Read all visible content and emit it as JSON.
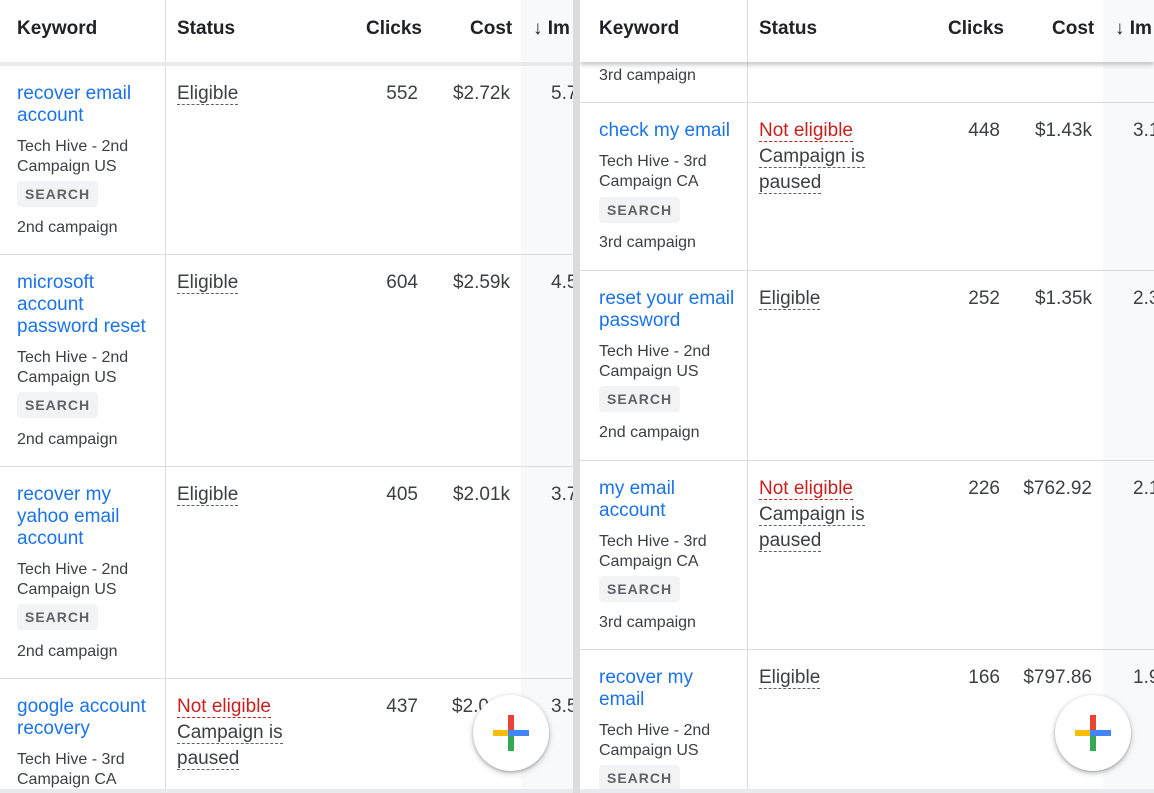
{
  "headers": {
    "keyword": "Keyword",
    "status": "Status",
    "clicks": "Clicks",
    "cost": "Cost",
    "impr": "↓ Im"
  },
  "left": {
    "rows": [
      {
        "keyword": "recover email account",
        "campaign": "Tech Hive - 2nd Campaign US",
        "chip": "SEARCH",
        "group": "2nd campaign",
        "status": "Eligible",
        "clicks": "552",
        "cost": "$2.72k",
        "impr": "5.7"
      },
      {
        "keyword": "microsoft account password reset",
        "campaign": "Tech Hive - 2nd Campaign US",
        "chip": "SEARCH",
        "group": "2nd campaign",
        "status": "Eligible",
        "clicks": "604",
        "cost": "$2.59k",
        "impr": "4.5"
      },
      {
        "keyword": "recover my yahoo email account",
        "campaign": "Tech Hive - 2nd Campaign US",
        "chip": "SEARCH",
        "group": "2nd campaign",
        "status": "Eligible",
        "clicks": "405",
        "cost": "$2.01k",
        "impr": "3.7"
      },
      {
        "keyword": "google account recovery",
        "campaign": "Tech Hive - 3rd Campaign CA",
        "status": "Not eligible",
        "status_sub": "Campaign is paused",
        "clicks": "437",
        "cost": "$2.0",
        "impr": "3.5"
      }
    ]
  },
  "right": {
    "partial_group": "3rd campaign",
    "rows": [
      {
        "keyword": "check my email",
        "campaign": "Tech Hive - 3rd Campaign CA",
        "chip": "SEARCH",
        "group": "3rd campaign",
        "status": "Not eligible",
        "status_sub": "Campaign is paused",
        "clicks": "448",
        "cost": "$1.43k",
        "impr": "3.1"
      },
      {
        "keyword": "reset your email password",
        "campaign": "Tech Hive - 2nd Campaign US",
        "chip": "SEARCH",
        "group": "2nd campaign",
        "status": "Eligible",
        "clicks": "252",
        "cost": "$1.35k",
        "impr": "2.3"
      },
      {
        "keyword": "my email account",
        "campaign": "Tech Hive - 3rd Campaign CA",
        "chip": "SEARCH",
        "group": "3rd campaign",
        "status": "Not eligible",
        "status_sub": "Campaign is paused",
        "clicks": "226",
        "cost": "$762.92",
        "impr": "2.1"
      },
      {
        "keyword": "recover my email",
        "campaign": "Tech Hive - 2nd Campaign US",
        "chip": "SEARCH",
        "status": "Eligible",
        "clicks": "166",
        "cost": "$797.86",
        "impr": "1.9"
      }
    ]
  },
  "fab_icon": "plus-icon",
  "colors": {
    "link": "#1a73e8",
    "error": "#c5221f",
    "google_blue": "#4285f4",
    "google_red": "#ea4335",
    "google_yellow": "#fbbc04",
    "google_green": "#34a853"
  }
}
